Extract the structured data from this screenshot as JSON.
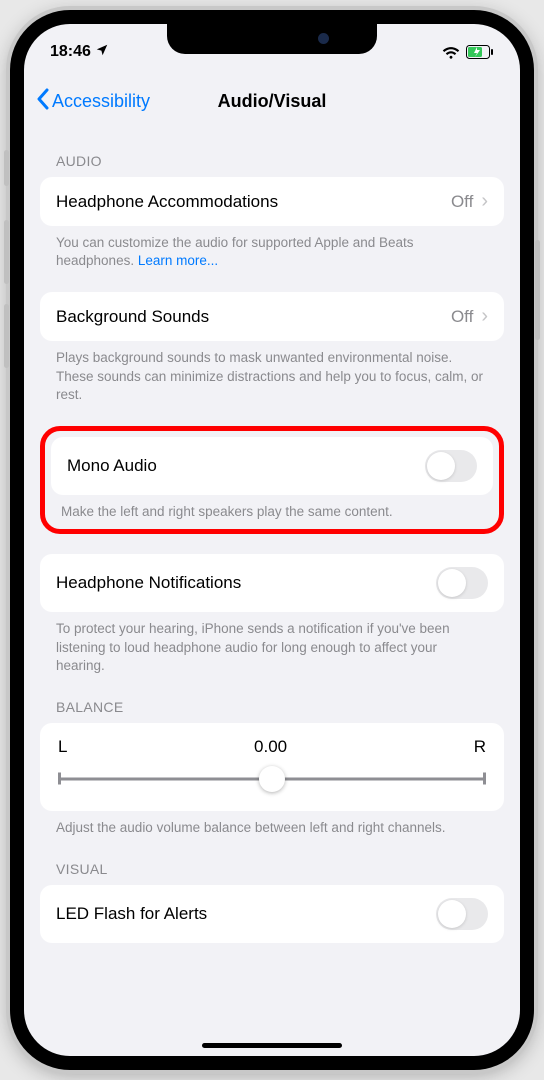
{
  "status": {
    "time": "18:46"
  },
  "nav": {
    "back_label": "Accessibility",
    "title": "Audio/Visual"
  },
  "sections": {
    "audio_header": "AUDIO",
    "balance_header": "BALANCE",
    "visual_header": "VISUAL"
  },
  "cells": {
    "headphone_accom": {
      "label": "Headphone Accommodations",
      "value": "Off"
    },
    "background_sounds": {
      "label": "Background Sounds",
      "value": "Off"
    },
    "mono_audio": {
      "label": "Mono Audio"
    },
    "headphone_notif": {
      "label": "Headphone Notifications"
    },
    "led_flash": {
      "label": "LED Flash for Alerts"
    }
  },
  "footers": {
    "headphone_accom": "You can customize the audio for supported Apple and Beats headphones. ",
    "learn_more": "Learn more...",
    "background_sounds": "Plays background sounds to mask unwanted environmental noise. These sounds can minimize distractions and help you to focus, calm, or rest.",
    "mono_audio": "Make the left and right speakers play the same content.",
    "headphone_notif": "To protect your hearing, iPhone sends a notification if you've been listening to loud headphone audio for long enough to affect your hearing.",
    "balance": "Adjust the audio volume balance between left and right channels."
  },
  "balance": {
    "left": "L",
    "right": "R",
    "value": "0.00"
  }
}
